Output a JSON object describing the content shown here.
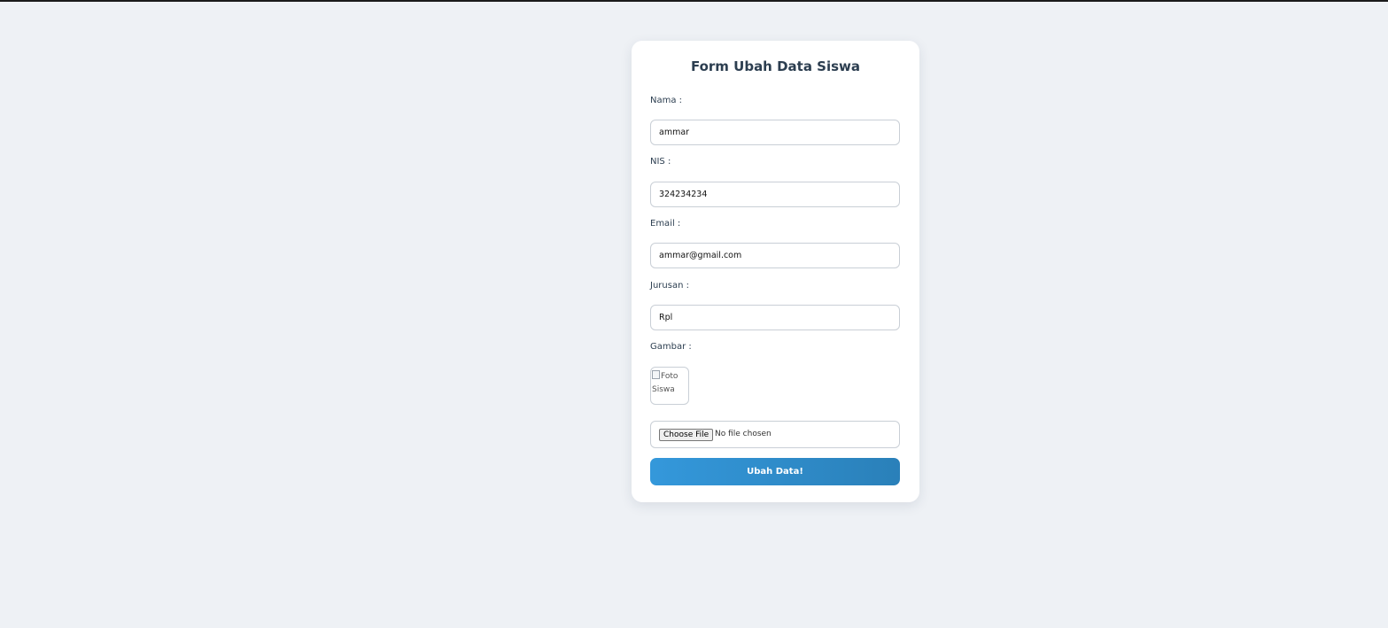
{
  "form": {
    "title": "Form Ubah Data Siswa",
    "fields": {
      "nama": {
        "label": "Nama :",
        "value": "ammar"
      },
      "nis": {
        "label": "NIS :",
        "value": "324234234"
      },
      "email": {
        "label": "Email :",
        "value": "ammar@gmail.com"
      },
      "jurusan": {
        "label": "Jurusan :",
        "value": "Rpl"
      }
    },
    "gambar": {
      "label": "Gambar :",
      "alt_text": "Foto Siswa",
      "file_button": "Choose File",
      "file_status": "No file chosen"
    },
    "submit_label": "Ubah Data!"
  },
  "colors": {
    "page_background": "#eef1f5",
    "card_background": "#ffffff",
    "title_text": "#2c3e50",
    "button_start": "#3498db",
    "button_end": "#2a80b9"
  }
}
